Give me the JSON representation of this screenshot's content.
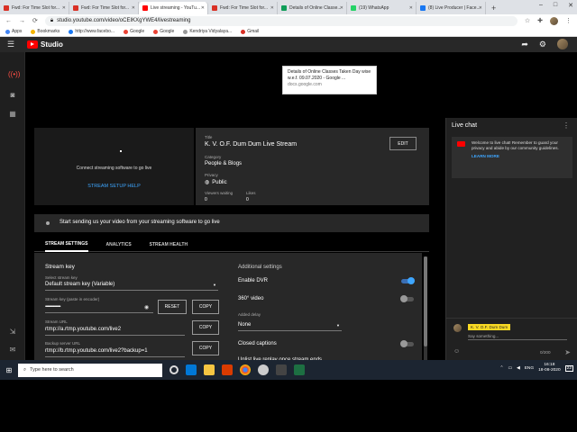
{
  "colors": {
    "accent": "#3ea6ff",
    "brand_red": "#ff0000",
    "bg": "#1f1f1f",
    "panel": "#282828"
  },
  "browser": {
    "tabs": [
      {
        "label": "Fwd: For Time Slot for...",
        "color": "#d93025",
        "active": false
      },
      {
        "label": "Fwd: For Time Slot for...",
        "color": "#d93025",
        "active": false
      },
      {
        "label": "Live streaming - YouTu...",
        "color": "#ff0000",
        "active": true
      },
      {
        "label": "Fwd: For Time Slot for...",
        "color": "#d93025",
        "active": false
      },
      {
        "label": "Details of Online Classe...",
        "color": "#0f9d58",
        "active": false
      },
      {
        "label": "(19) WhatsApp",
        "color": "#25d366",
        "active": false
      },
      {
        "label": "(8) Live Producer | Face...",
        "color": "#1877f2",
        "active": false
      }
    ],
    "new_tab": "+",
    "url": "studio.youtube.com/video/oCEIKXgYWE4/livestreaming",
    "bookmarks": [
      "Apps",
      "Bookmarks",
      "http://www.facebo...",
      "Google",
      "Google",
      "Kendriya Vidyalaya...",
      "Gmail"
    ],
    "tooltip": {
      "title": "Details of Online Classes Taken Day wise w.e.f. 09.07.2020 - Google ...",
      "url": "docs.google.com"
    }
  },
  "studio": {
    "logo_text": "Studio",
    "preview_message": "Connect streaming software to go live",
    "setup_help": "STREAM SETUP HELP",
    "title_label": "Title",
    "title_value": "K. V. O.F. Dum Dum Live Stream",
    "edit": "EDIT",
    "category_label": "Category",
    "category_value": "People & Blogs",
    "privacy_label": "Privacy",
    "privacy_value": "Public",
    "viewers_label": "Viewers waiting",
    "viewers_value": "0",
    "likes_label": "Likes",
    "likes_value": "0",
    "status_message": "Start sending us your video from your streaming software to go live",
    "tabs": [
      "STREAM SETTINGS",
      "ANALYTICS",
      "STREAM HEALTH"
    ],
    "stream_key_heading": "Stream key",
    "select_key_label": "Select stream key",
    "select_key_value": "Default stream key (Variable)",
    "key_label": "Stream key (paste in encoder)",
    "key_value": "••••••••••••••••••••••",
    "reset": "RESET",
    "copy": "COPY",
    "url_label": "Stream URL",
    "url_value": "rtmp://a.rtmp.youtube.com/live2",
    "backup_label": "Backup server URL",
    "backup_value": "rtmp://b.rtmp.youtube.com/live2?backup=1",
    "additional_heading": "Additional settings",
    "enable_dvr": "Enable DVR",
    "video360": "360° video",
    "delay_label": "Added delay",
    "delay_value": "None",
    "closed_captions": "Closed captions",
    "unlist": "Unlist live replay once stream ends"
  },
  "chat": {
    "title": "Live chat",
    "welcome": "Welcome to live chat! Remember to guard your privacy and abide by our community guidelines.",
    "learn_more": "LEARN MORE",
    "user_name": "K. V. O.F. Dum Dum",
    "placeholder": "Say something...",
    "count": "0/200"
  },
  "taskbar": {
    "search_placeholder": "Type here to search",
    "lang": "ENG",
    "time": "16:18",
    "date": "18-08-2020",
    "notification_count": "22"
  }
}
